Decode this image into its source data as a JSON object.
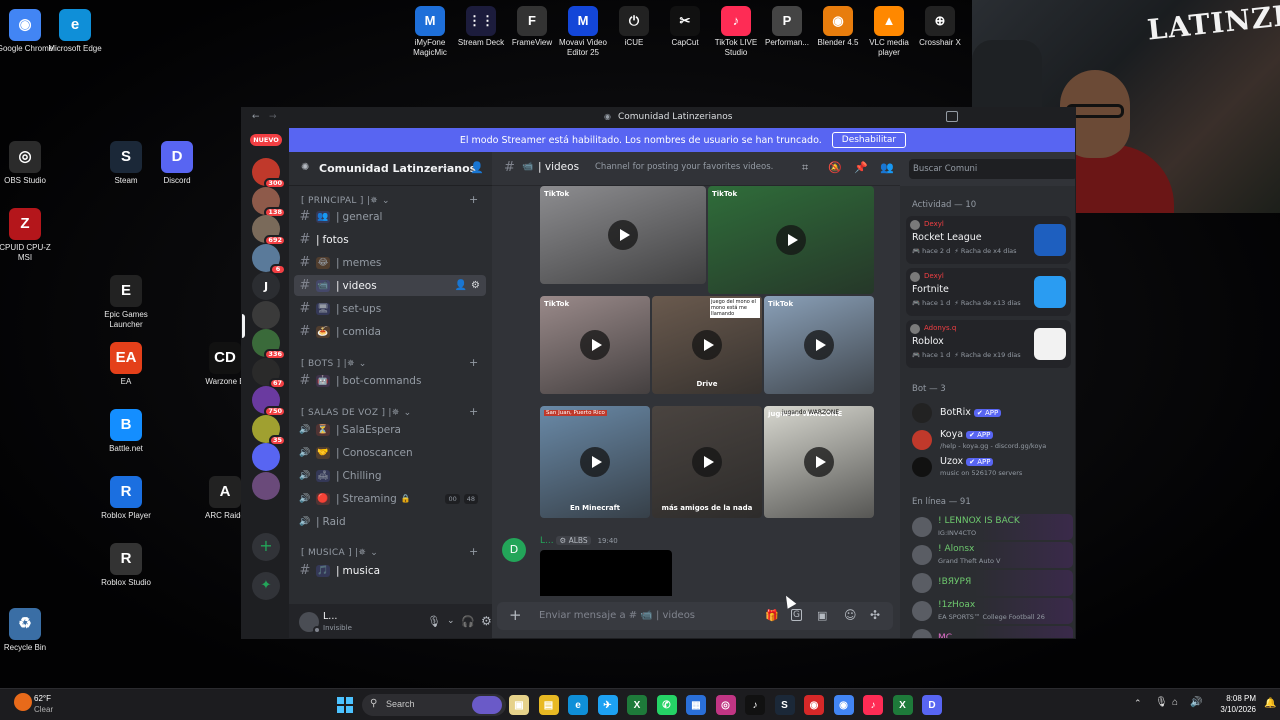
{
  "desktop": {
    "left_icons": [
      {
        "label": "Google Chrome",
        "color": "#4285f4",
        "glyph": "◉"
      },
      {
        "label": "Microsoft Edge",
        "color": "#0f8fd8",
        "glyph": "e"
      },
      {
        "label": "OBS Studio",
        "color": "#2b2b2b",
        "glyph": "◎"
      },
      {
        "label": "Steam",
        "color": "#1b2838",
        "glyph": "S"
      },
      {
        "label": "Discord",
        "color": "#5865f2",
        "glyph": "D"
      },
      {
        "label": "CPUID CPU-Z MSI",
        "color": "#b4161b",
        "glyph": "Z"
      },
      {
        "label": "Epic Games Launcher",
        "color": "#222",
        "glyph": "E"
      },
      {
        "label": "EA",
        "color": "#e4401a",
        "glyph": "EA"
      },
      {
        "label": "Warzone E",
        "color": "#111",
        "glyph": "CD"
      },
      {
        "label": "Battle.net",
        "color": "#148eff",
        "glyph": "B"
      },
      {
        "label": "Roblox Player",
        "color": "#1b6fe0",
        "glyph": "R"
      },
      {
        "label": "ARC Raide",
        "color": "#222",
        "glyph": "A"
      },
      {
        "label": "Roblox Studio",
        "color": "#333",
        "glyph": "R"
      },
      {
        "label": "Recycle Bin",
        "color": "#3a6ea5",
        "glyph": "♻"
      }
    ],
    "top_icons": [
      {
        "label": "iMyFone MagicMic",
        "color": "#1e6fd9",
        "glyph": "M"
      },
      {
        "label": "Stream Deck",
        "color": "#1c1c3c",
        "glyph": "⋮⋮"
      },
      {
        "label": "FrameView",
        "color": "#333",
        "glyph": "F"
      },
      {
        "label": "Movavi Video Editor 25",
        "color": "#1346d8",
        "glyph": "M"
      },
      {
        "label": "iCUE",
        "color": "#222",
        "glyph": "⏻"
      },
      {
        "label": "CapCut",
        "color": "#111",
        "glyph": "✂"
      },
      {
        "label": "TikTok LIVE Studio",
        "color": "#fe2c55",
        "glyph": "♪"
      },
      {
        "label": "Performan...",
        "color": "#444",
        "glyph": "P"
      },
      {
        "label": "Blender 4.5",
        "color": "#e87d0d",
        "glyph": "◉"
      },
      {
        "label": "VLC media player",
        "color": "#ff8800",
        "glyph": "▲"
      },
      {
        "label": "Crosshair X",
        "color": "#222",
        "glyph": "⊕"
      }
    ]
  },
  "webcam": {
    "overlay_text": "LATINZER!"
  },
  "discord": {
    "window_title": "Comunidad Latinzerianos",
    "streamer_banner": "El modo Streamer está habilitado. Los nombres de usuario se han truncado.",
    "streamer_button": "Deshabilitar",
    "new_label": "NUEVO",
    "servers": [
      {
        "badge": "300",
        "color": "#c0392b"
      },
      {
        "badge": "138",
        "color": "#8e5a4a"
      },
      {
        "badge": "692",
        "color": "#7a6a5a"
      },
      {
        "badge": "6",
        "color": "#5a7a9a"
      },
      {
        "badge": "",
        "color": "#2b2d31",
        "text": "J"
      },
      {
        "badge": "",
        "color": "#3a3a3a"
      },
      {
        "badge": "336",
        "color": "#3a6a3a"
      },
      {
        "badge": "67",
        "color": "#2a2a2a"
      },
      {
        "badge": "750",
        "color": "#6a3aa0"
      },
      {
        "badge": "35",
        "color": "#a0a030"
      },
      {
        "badge": "",
        "color": "#5865f2"
      },
      {
        "badge": "",
        "color": "#6a4a7a"
      }
    ],
    "guild_name": "Comunidad Latinzerianos",
    "categories": [
      {
        "label": "[ PRINCIPAL ] |✵"
      },
      {
        "label": "[ BOTS ] |✵"
      },
      {
        "label": "[ SALAS DE VOZ ] |✵"
      },
      {
        "label": "[ MUSICA ] |✵"
      }
    ],
    "channels": [
      {
        "name": "general",
        "emoji": "👥"
      },
      {
        "name": "fotos",
        "emoji": ""
      },
      {
        "name": "memes",
        "emoji": "😂"
      },
      {
        "name": "videos",
        "emoji": "📹"
      },
      {
        "name": "set-ups",
        "emoji": "🖥"
      },
      {
        "name": "comida",
        "emoji": "🍝"
      },
      {
        "name": "bot-commands",
        "emoji": "🤖"
      },
      {
        "name": "SalaEspera",
        "emoji": "⏳"
      },
      {
        "name": "Conoscancen",
        "emoji": "🤝"
      },
      {
        "name": "Chilling",
        "emoji": "🛋"
      },
      {
        "name": "Streaming",
        "emoji": "🔴"
      },
      {
        "name": "Raid",
        "emoji": ""
      },
      {
        "name": "musica",
        "emoji": "🎵"
      }
    ],
    "streaming_counts": [
      "00",
      "48"
    ],
    "user": {
      "name": "L...",
      "status": "Invisible"
    },
    "header": {
      "channel": "videos",
      "topic": "Channel for posting your favorites videos.",
      "search_placeholder": "Buscar Comuni"
    },
    "videos": [
      {
        "caption": "TikTok",
        "bg": "#8d8d90"
      },
      {
        "caption": "TikTok",
        "bg": "#2f6d3a"
      },
      {
        "caption": "TikTok",
        "bg": "#9a8a8a"
      },
      {
        "caption": "Drive",
        "bg": "#6a5a4e"
      },
      {
        "caption": "TikTok",
        "bg": "#8aa0b8"
      },
      {
        "caption": "En Minecraft",
        "bg": "#6a8aa8"
      },
      {
        "caption": "más amigos de la nada",
        "bg": "#4a4440"
      },
      {
        "caption": "jugando WARZONE",
        "bg": "#d8d8d0"
      }
    ],
    "video_overlays": {
      "top_right": "juego del mono el mono está me llamando",
      "san_juan": "San Juan, Puerto Rico",
      "warzone": "jugando WARZONE"
    },
    "message": {
      "author": "L...",
      "tag": "ALBS",
      "time": "19:40"
    },
    "composer_placeholder": "Enviar mensaje a # 📹 | videos",
    "activity_header": "Actividad — 10",
    "activities": [
      {
        "user": "Dexyl",
        "game": "Rocket League",
        "meta": "hace 2 d",
        "streak": "Racha de x4 días",
        "icon_color": "#1e5fbf"
      },
      {
        "user": "Dexyl",
        "game": "Fortnite",
        "meta": "hace 1 d",
        "streak": "Racha de x13 días",
        "icon_color": "#2a9cf2"
      },
      {
        "user": "Adonys.q",
        "game": "Roblox",
        "meta": "hace 1 d",
        "streak": "Racha de x19 días",
        "icon_color": "#f2f2f2"
      }
    ],
    "bot_header": "Bot — 3",
    "bots": [
      {
        "name": "BotRix",
        "tag": "APP",
        "sub": "",
        "color": "#222"
      },
      {
        "name": "Koya",
        "tag": "APP",
        "sub": "/help - koya.gg - discord.gg/koya",
        "color": "#c0392b"
      },
      {
        "name": "Uzox",
        "tag": "APP",
        "sub": "music on 526170 servers",
        "color": "#111"
      }
    ],
    "online_header": "En línea — 91",
    "online": [
      {
        "name": "! LENNOX IS BACK",
        "sub": "IG:INV4CTO",
        "color": "#6ec96e"
      },
      {
        "name": "! Alonsx",
        "sub": "Grand Theft Auto V",
        "color": "#6ec96e"
      },
      {
        "name": "!BЯУРЯ",
        "sub": "",
        "color": "#6ec96e"
      },
      {
        "name": "!1zHoax",
        "sub": "EA SPORTS™ College Football 26",
        "color": "#6ec96e"
      },
      {
        "name": "MC",
        "sub": "",
        "color": "#e06ec9"
      }
    ]
  },
  "taskbar": {
    "weather_temp": "62°F",
    "weather_desc": "Clear",
    "search_label": "Search",
    "time": "8:08 PM",
    "date": "3/10/2026",
    "apps": [
      {
        "color": "#e6d28a",
        "glyph": "▣"
      },
      {
        "color": "#e8b923",
        "glyph": "▤"
      },
      {
        "color": "#0f8fd8",
        "glyph": "e"
      },
      {
        "color": "#1da1f2",
        "glyph": "✈"
      },
      {
        "color": "#1e7a3a",
        "glyph": "X"
      },
      {
        "color": "#25d366",
        "glyph": "✆"
      },
      {
        "color": "#2a6fd8",
        "glyph": "▦"
      },
      {
        "color": "#c13584",
        "glyph": "◎"
      },
      {
        "color": "#111",
        "glyph": "♪"
      },
      {
        "color": "#1b2838",
        "glyph": "S"
      },
      {
        "color": "#d62828",
        "glyph": "◉"
      },
      {
        "color": "#4285f4",
        "glyph": "◉"
      },
      {
        "color": "#fe2c55",
        "glyph": "♪"
      },
      {
        "color": "#1e7a3a",
        "glyph": "X"
      },
      {
        "color": "#5865f2",
        "glyph": "D"
      }
    ]
  }
}
